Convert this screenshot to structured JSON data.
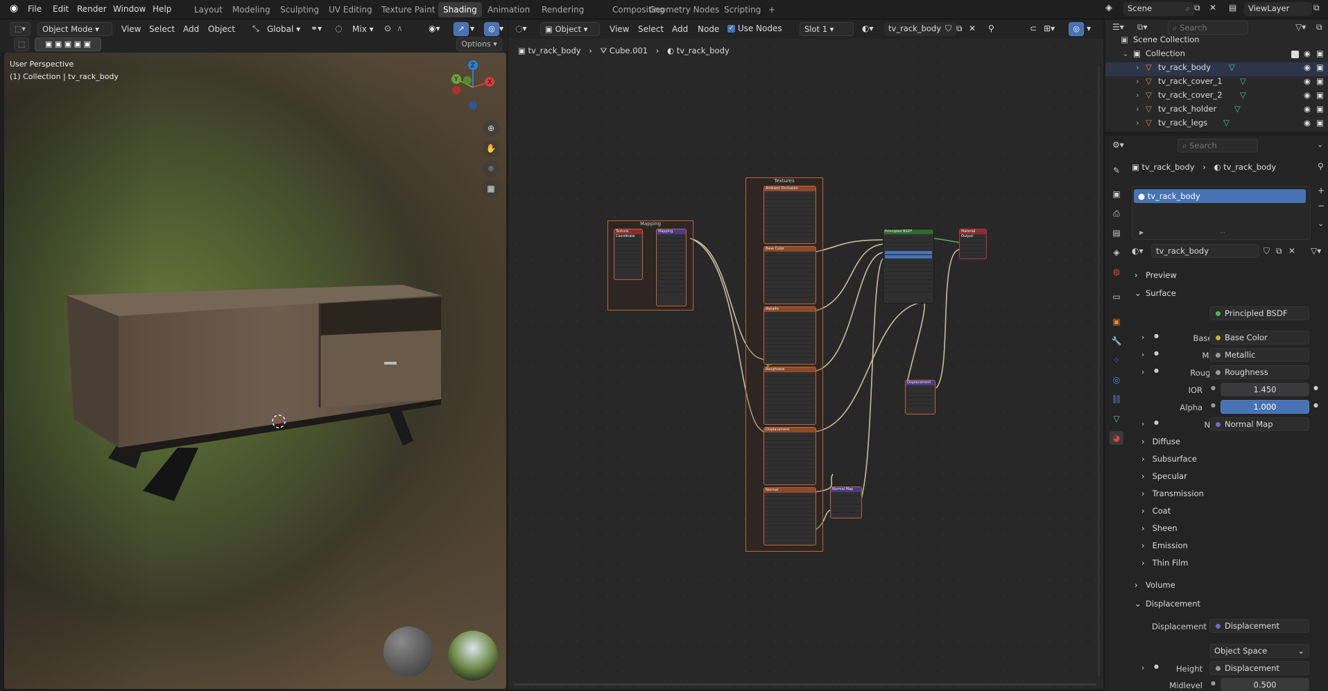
{
  "topbar": {
    "menus": [
      "File",
      "Edit",
      "Render",
      "Window",
      "Help"
    ],
    "workspaces": [
      "Layout",
      "Modeling",
      "Sculpting",
      "UV Editing",
      "Texture Paint",
      "Shading",
      "Animation",
      "Rendering",
      "Compositing",
      "Geometry Nodes",
      "Scripting"
    ],
    "active_workspace": "Shading",
    "add_workspace": "+",
    "scene": "Scene",
    "view_layer": "ViewLayer"
  },
  "viewport": {
    "mode": "Object Mode",
    "menus": [
      "View",
      "Select",
      "Add",
      "Object"
    ],
    "orientation": "Global",
    "pivot": "Mix",
    "options": "Options",
    "perspective": "User Perspective",
    "collection_info": "(1) Collection | tv_rack_body",
    "gizmo_axes": {
      "x": "X",
      "y": "Y",
      "z": "Z"
    }
  },
  "node_editor": {
    "type": "Object",
    "menus": [
      "View",
      "Select",
      "Add",
      "Node"
    ],
    "use_nodes": "Use Nodes",
    "slot": "Slot 1",
    "material": "tv_rack_body",
    "breadcrumb": [
      "tv_rack_body",
      "Cube.001",
      "tv_rack_body"
    ],
    "frames": {
      "mapping": "Mapping",
      "textures": "Textures"
    },
    "nodes": {
      "texcoord": "Texture Coordinate",
      "mapping": "Mapping",
      "ao": "Ambient Occlusion",
      "basecolor": "Base Color",
      "metallic": "Metallic",
      "roughness": "Roughness",
      "displacement_tex": "Displacement",
      "normal_tex": "Normal",
      "bsdf": "Principled BSDF",
      "output": "Material Output",
      "disp": "Displacement",
      "normalmap": "Normal Map"
    }
  },
  "outliner": {
    "search_placeholder": "Search",
    "scene_collection": "Scene Collection",
    "collection": "Collection",
    "objects": [
      "tv_rack_body",
      "tv_rack_cover_1",
      "tv_rack_cover_2",
      "tv_rack_holder",
      "tv_rack_legs"
    ]
  },
  "properties": {
    "search_placeholder": "Search",
    "breadcrumb": [
      "tv_rack_body",
      "tv_rack_body"
    ],
    "material_slot": "tv_rack_body",
    "material_name": "tv_rack_body",
    "panels": {
      "preview": "Preview",
      "surface": "Surface",
      "volume": "Volume",
      "displacement": "Displacement"
    },
    "surface_rows": [
      {
        "label": "Surface",
        "value": "Principled BSDF",
        "dot": "#3fbf5a"
      },
      {
        "label": "Base Co...",
        "value": "Base Color",
        "dot": "#c7b23a"
      },
      {
        "label": "Metallic",
        "value": "Metallic",
        "dot": "#9a9a9a"
      },
      {
        "label": "Roughne...",
        "value": "Roughness",
        "dot": "#9a9a9a"
      },
      {
        "label": "IOR",
        "value": "1.450",
        "dot": "#9a9a9a"
      },
      {
        "label": "Alpha",
        "value": "1.000",
        "dot": "#9a9a9a"
      },
      {
        "label": "Normal",
        "value": "Normal Map",
        "dot": "#6a6ad8"
      }
    ],
    "subpanels": [
      "Diffuse",
      "Subsurface",
      "Specular",
      "Transmission",
      "Coat",
      "Sheen",
      "Emission",
      "Thin Film"
    ],
    "disp_rows": [
      {
        "label": "Displacement",
        "value": "Displacement",
        "dot": "#6a6ad8"
      },
      {
        "label": "",
        "value": "Object Space"
      },
      {
        "label": "Height",
        "value": "Displacement",
        "dot": "#9a9a9a"
      },
      {
        "label": "Midlevel",
        "value": "0.500",
        "dot": "#9a9a9a"
      }
    ]
  },
  "colors": {
    "accent": "#4772b3",
    "frame": "#c0653a",
    "wire": "#d9d2a8"
  }
}
